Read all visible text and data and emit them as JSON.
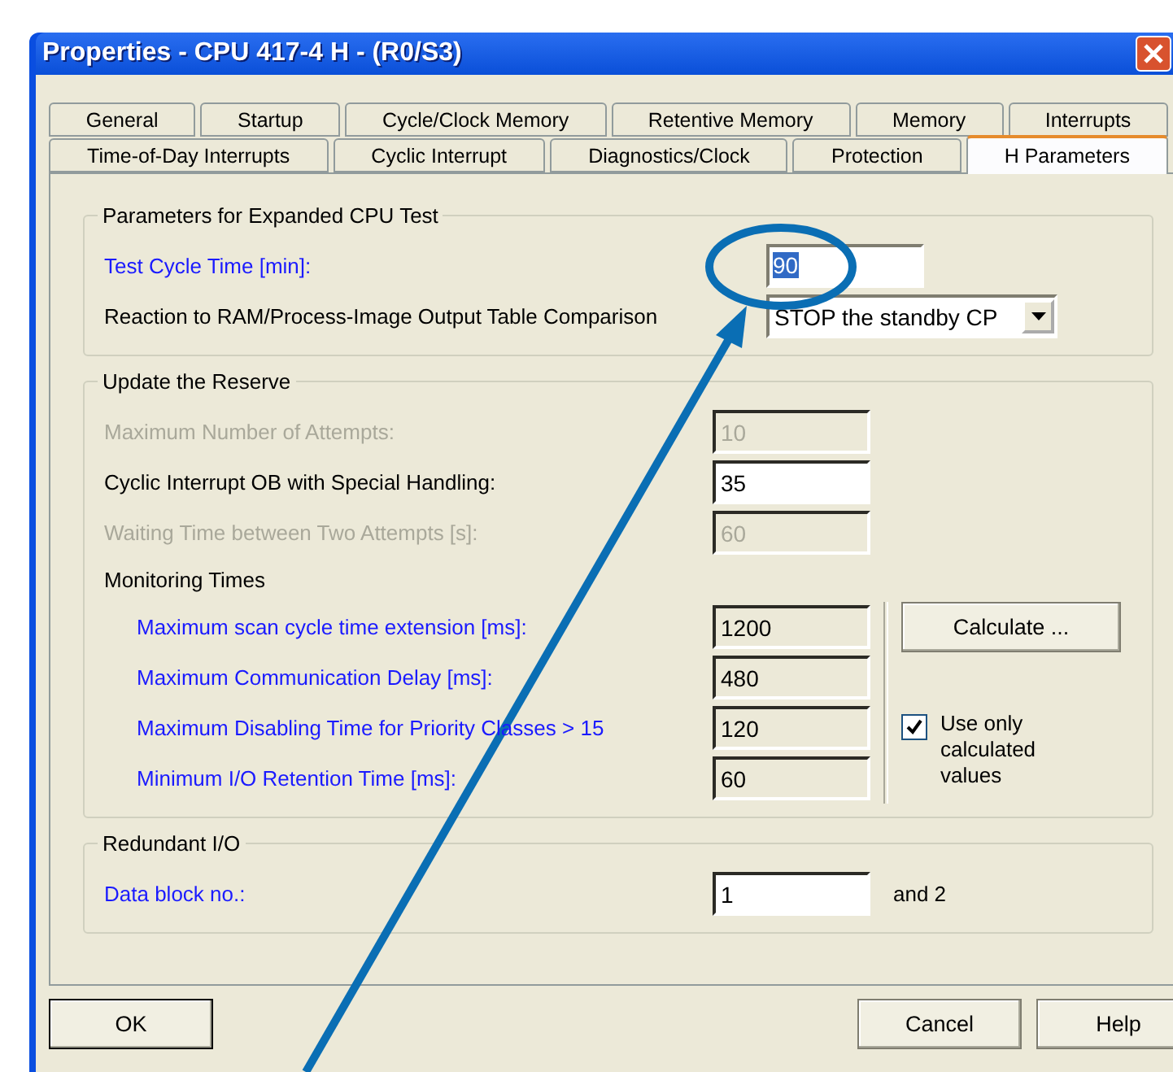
{
  "window": {
    "title": "Properties - CPU 417-4 H - (R0/S3)"
  },
  "tab_rows": [
    {
      "tabs": [
        {
          "label": "General",
          "selected": false
        },
        {
          "label": "Startup",
          "selected": false
        },
        {
          "label": "Cycle/Clock Memory",
          "selected": false
        },
        {
          "label": "Retentive Memory",
          "selected": false
        },
        {
          "label": "Memory",
          "selected": false
        },
        {
          "label": "Interrupts",
          "selected": false
        }
      ]
    },
    {
      "tabs": [
        {
          "label": "Time-of-Day Interrupts",
          "selected": false
        },
        {
          "label": "Cyclic Interrupt",
          "selected": false
        },
        {
          "label": "Diagnostics/Clock",
          "selected": false
        },
        {
          "label": "Protection",
          "selected": false
        },
        {
          "label": "H Parameters",
          "selected": true
        }
      ]
    }
  ],
  "cpu_test": {
    "title": "Parameters for Expanded CPU Test",
    "rows": [
      {
        "kind": "field",
        "label": "Test Cycle Time [min]:",
        "highlighted": true,
        "disabled": false,
        "value": "90",
        "text_selected": true
      },
      {
        "kind": "dropdown",
        "label": "Reaction to RAM/Process-Image Output Table Comparison",
        "highlighted": false,
        "disabled": false,
        "value": "STOP the standby CP"
      }
    ]
  },
  "reserve": {
    "title": "Update the Reserve",
    "rows": [
      {
        "label": "Maximum Number of Attempts:",
        "highlighted": false,
        "disabled": true,
        "value": "10"
      },
      {
        "label": "Cyclic Interrupt OB with Special Handling:",
        "highlighted": false,
        "disabled": false,
        "value": "35"
      },
      {
        "label": "Waiting Time between Two Attempts [s]:",
        "highlighted": false,
        "disabled": true,
        "value": "60"
      }
    ],
    "subheading": "Monitoring Times",
    "monitoring": [
      {
        "label": "Maximum scan cycle time extension [ms]:",
        "highlighted": true,
        "disabled": true,
        "value": "1200"
      },
      {
        "label": "Maximum Communication Delay [ms]:",
        "highlighted": true,
        "disabled": true,
        "value": "480"
      },
      {
        "label": "Maximum Disabling Time for Priority Classes > 15",
        "highlighted": true,
        "disabled": true,
        "value": "120"
      },
      {
        "label": "Minimum I/O Retention Time [ms]:",
        "highlighted": true,
        "disabled": true,
        "value": "60"
      }
    ],
    "calculate_button": "Calculate ...",
    "checkbox": {
      "label": "Use only calculated values",
      "checked": true
    }
  },
  "redundant_io": {
    "title": "Redundant I/O",
    "label": "Data block no.:",
    "highlighted": true,
    "value": "1",
    "suffix": "and  2"
  },
  "buttons": [
    {
      "label": "OK",
      "default": true
    },
    {
      "label": "Cancel",
      "default": false
    },
    {
      "label": "Help",
      "default": false
    }
  ]
}
